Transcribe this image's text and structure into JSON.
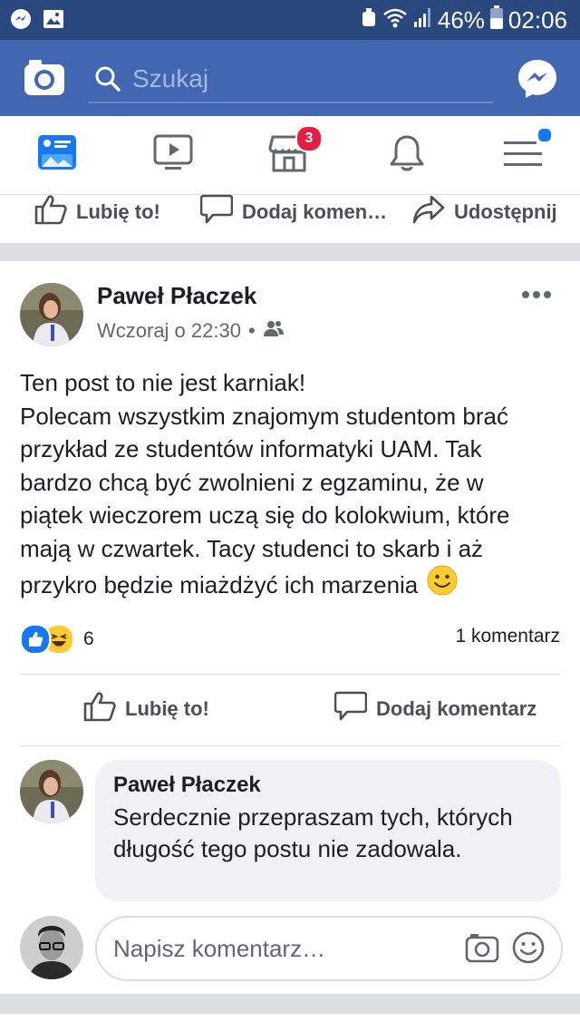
{
  "status_bar": {
    "battery": "46%",
    "time": "02:06"
  },
  "search": {
    "placeholder": "Szukaj"
  },
  "tabs": {
    "marketplace_badge": "3"
  },
  "prev_post_actions": {
    "like": "Lubię to!",
    "comment": "Dodaj komen…",
    "share": "Udostępnij"
  },
  "post": {
    "author": "Paweł Płaczek",
    "time": "Wczoraj o 22:30",
    "privacy_sep": "•",
    "text_lines": [
      "Ten post to nie jest karniak!",
      "Polecam wszystkim znajomym studentom brać",
      "przykład ze studentów informatyki UAM. Tak",
      "bardzo chcą być zwolnieni z egzaminu, że w",
      "piątek wieczorem uczą się do kolokwium, które",
      "mają w czwartek. Tacy studenci to skarb i aż",
      "przykro będzie miażdżyć ich marzenia"
    ],
    "reaction_count": "6",
    "comment_count": "1 komentarz",
    "like_label": "Lubię to!",
    "comment_label": "Dodaj komentarz"
  },
  "comment": {
    "author": "Paweł Płaczek",
    "text": "Serdecznie przepraszam tych, których długość tego postu nie zadowala."
  },
  "composer": {
    "placeholder": "Napisz komentarz…"
  },
  "colors": {
    "fb_blue": "#4267b2",
    "status_blue": "#29487d",
    "badge_red": "#e41e3f",
    "like_blue": "#1877f2"
  }
}
